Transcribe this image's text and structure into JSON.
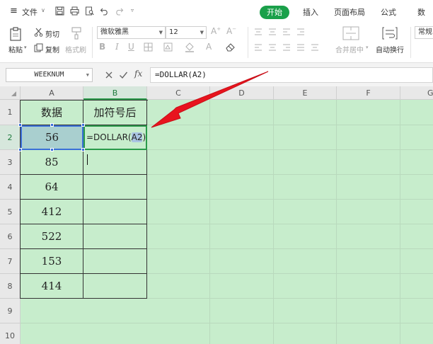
{
  "menubar": {
    "file_label": "文件",
    "tabs": [
      "开始",
      "插入",
      "页面布局",
      "公式",
      "数"
    ]
  },
  "ribbon": {
    "paste_label": "粘贴",
    "cut_label": "剪切",
    "copy_label": "复制",
    "format_painter_label": "格式刷",
    "font_name": "微软雅黑",
    "font_size": "12",
    "merge_label": "合并居中",
    "wrap_label": "自动换行",
    "number_format": "常规"
  },
  "formula_bar": {
    "name_box": "WEEKNUM",
    "fx_label": "fx",
    "formula": "=DOLLAR(A2)"
  },
  "grid": {
    "columns": [
      "A",
      "B",
      "C",
      "D",
      "E",
      "F",
      "G"
    ],
    "rows": [
      "1",
      "2",
      "3",
      "4",
      "5",
      "6",
      "7",
      "8",
      "9",
      "10"
    ],
    "header_a1": "数据",
    "header_b1": "加符号后",
    "values_a": [
      "56",
      "85",
      "64",
      "412",
      "522",
      "153",
      "414"
    ],
    "editing_prefix": "=DOLLAR(",
    "editing_ref": "A2",
    "editing_suffix": ")"
  },
  "colors": {
    "accent": "#1aa04a",
    "sheet_background": "#c7edcc",
    "arrow": "#e8141e"
  }
}
